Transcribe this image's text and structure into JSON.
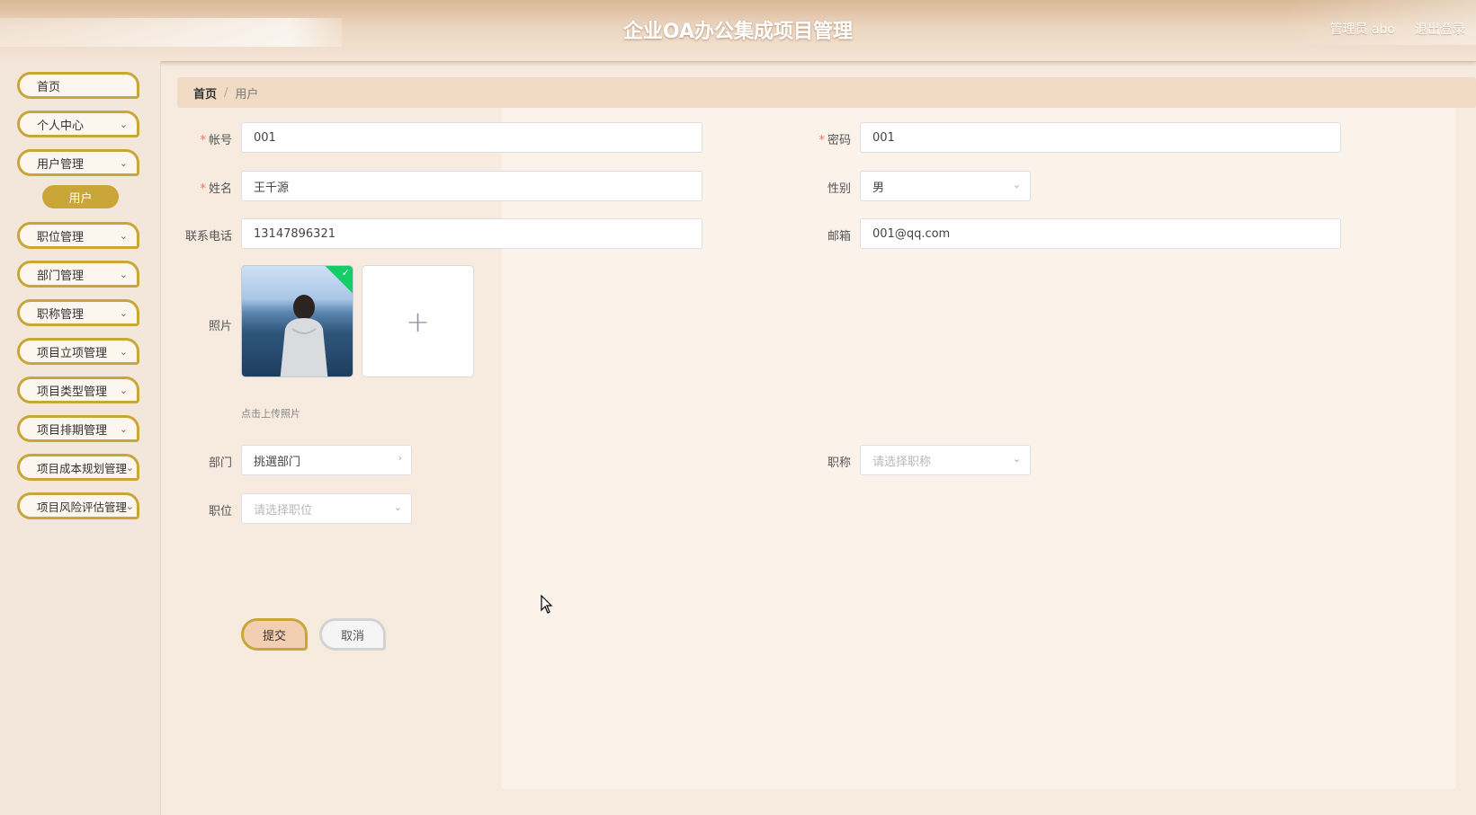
{
  "header": {
    "title": "企业OA办公集成项目管理",
    "user_label": "管理员 abo",
    "logout_label": "退出登录"
  },
  "sidebar": {
    "items": [
      {
        "label": "首页",
        "has_arrow": false
      },
      {
        "label": "个人中心",
        "has_arrow": true
      },
      {
        "label": "用户管理",
        "has_arrow": true
      },
      {
        "label": "职位管理",
        "has_arrow": true
      },
      {
        "label": "部门管理",
        "has_arrow": true
      },
      {
        "label": "职称管理",
        "has_arrow": true
      },
      {
        "label": "项目立项管理",
        "has_arrow": true
      },
      {
        "label": "项目类型管理",
        "has_arrow": true
      },
      {
        "label": "项目排期管理",
        "has_arrow": true
      },
      {
        "label": "项目成本规划管理",
        "has_arrow": true
      },
      {
        "label": "项目风险评估管理",
        "has_arrow": true
      }
    ],
    "active_sub_item": "用户"
  },
  "breadcrumb": {
    "home": "首页",
    "separator": "/",
    "current": "用户"
  },
  "form": {
    "account": {
      "label": "帐号",
      "value": "001",
      "required": true
    },
    "password": {
      "label": "密码",
      "value": "001",
      "required": true
    },
    "name": {
      "label": "姓名",
      "value": "王千源",
      "required": true
    },
    "gender": {
      "label": "性别",
      "value": "男"
    },
    "phone": {
      "label": "联系电话",
      "value": "13147896321"
    },
    "email": {
      "label": "邮箱",
      "value": "001@qq.com"
    },
    "photo": {
      "label": "照片",
      "hint": "点击上传照片"
    },
    "department": {
      "label": "部门",
      "placeholder": "挑選部门"
    },
    "title_rank": {
      "label": "职称",
      "placeholder": "请选择职称"
    },
    "position": {
      "label": "职位",
      "placeholder": "请选择职位"
    },
    "submit_label": "提交",
    "cancel_label": "取消"
  },
  "colors": {
    "accent_gold": "#c9a637",
    "breadcrumb_bg": "#f1dbc5",
    "success_green": "#13ce66",
    "required_red": "#f56c6c"
  }
}
